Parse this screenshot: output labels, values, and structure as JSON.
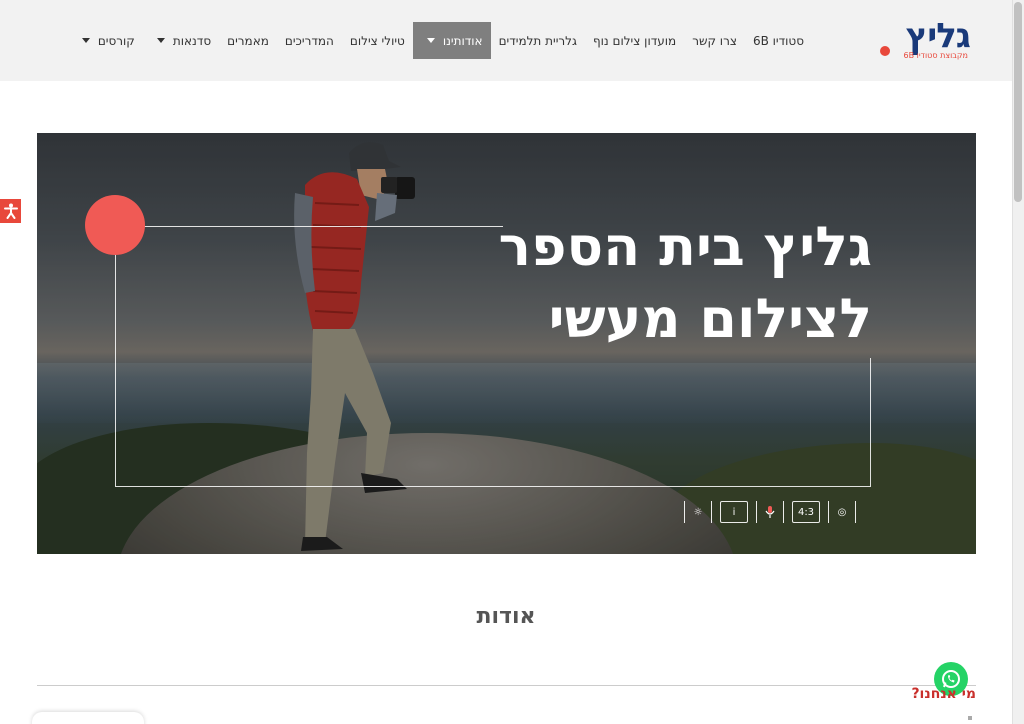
{
  "logo": {
    "text": "גליץ",
    "subtitle": "מקבוצת סטודיו 6B"
  },
  "nav": {
    "items": [
      {
        "label": "קורסים",
        "dropdown": true,
        "active": false
      },
      {
        "label": "סדנאות",
        "dropdown": true,
        "active": false
      },
      {
        "label": "מאמרים",
        "dropdown": false,
        "active": false
      },
      {
        "label": "המדריכים",
        "dropdown": false,
        "active": false
      },
      {
        "label": "טיולי צילום",
        "dropdown": false,
        "active": false
      },
      {
        "label": "אודותינו",
        "dropdown": true,
        "active": true
      },
      {
        "label": "גלריית תלמידים",
        "dropdown": false,
        "active": false
      },
      {
        "label": "מועדון צילום נוף",
        "dropdown": false,
        "active": false
      },
      {
        "label": "צרו קשר",
        "dropdown": false,
        "active": false
      },
      {
        "label": "סטודיו 6B",
        "dropdown": false,
        "active": false
      }
    ]
  },
  "hero": {
    "title_line1": "גליץ בית הספר",
    "title_line2": "לצילום מעשי",
    "camera_icons": {
      "ratio": "4:3",
      "info": "i"
    }
  },
  "about": {
    "title": "אודות",
    "who_text": "מי אנחנו?"
  },
  "colors": {
    "accent": "#e8483b",
    "brand": "#1a3a7a",
    "active_nav": "#7f7f7f",
    "whatsapp": "#25d366"
  }
}
